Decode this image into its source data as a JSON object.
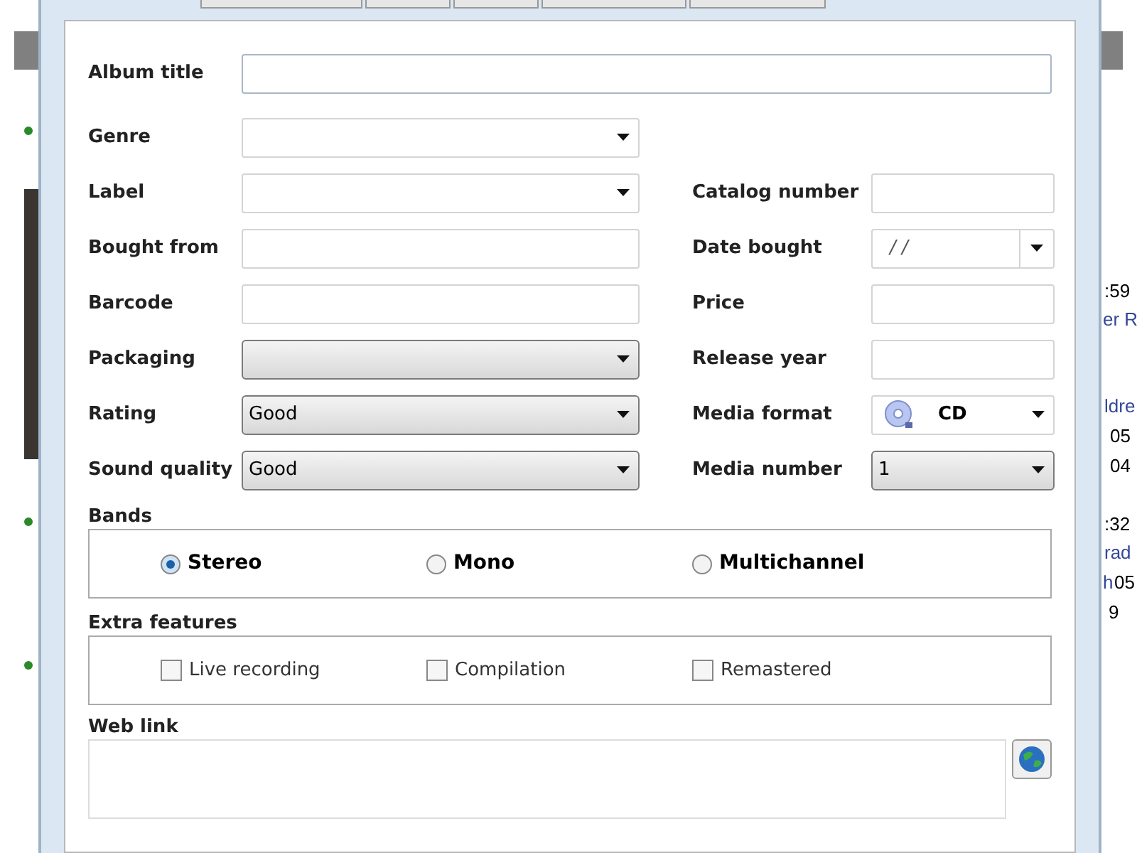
{
  "background_app": {
    "texts": [
      {
        "text": ":59",
        "link": false
      },
      {
        "text": "er R",
        "link": true
      },
      {
        "text": "ldre",
        "link": true
      },
      {
        "text": "05",
        "link": false
      },
      {
        "text": "04",
        "link": false
      },
      {
        "text": ":32",
        "link": false
      },
      {
        "text": "rad",
        "link": true
      },
      {
        "text": "h",
        "link": true
      },
      {
        "text": "05",
        "link": false
      },
      {
        "text": "9",
        "link": false
      }
    ]
  },
  "album_title": {
    "label": "Album title"
  },
  "rows": [
    {
      "left": {
        "label": "Genre",
        "kind": "combo"
      }
    },
    {
      "left": {
        "label": "Label",
        "kind": "combo"
      },
      "right": {
        "label": "Catalog number",
        "kind": "text"
      }
    },
    {
      "left": {
        "label": "Bought from",
        "kind": "text"
      },
      "right": {
        "label": "Date bought",
        "kind": "date",
        "value": "/ /"
      }
    },
    {
      "left": {
        "label": "Barcode",
        "kind": "text"
      },
      "right": {
        "label": "Price",
        "kind": "text"
      }
    },
    {
      "left": {
        "label": "Packaging",
        "kind": "dropdown"
      },
      "right": {
        "label": "Release year",
        "kind": "text"
      }
    },
    {
      "left": {
        "label": "Rating",
        "kind": "dropdown",
        "value": "Good"
      },
      "right": {
        "label": "Media format",
        "kind": "media",
        "value": "CD"
      }
    },
    {
      "left": {
        "label": "Sound quality",
        "kind": "dropdown",
        "value": "Good"
      },
      "right": {
        "label": "Media number",
        "kind": "dropdown",
        "value": "1"
      }
    }
  ],
  "bands": {
    "label": "Bands",
    "options": [
      {
        "label": "Stereo",
        "selected": true
      },
      {
        "label": "Mono",
        "selected": false
      },
      {
        "label": "Multichannel",
        "selected": false
      }
    ]
  },
  "extra_features": {
    "label": "Extra features",
    "options": [
      {
        "label": "Live recording",
        "checked": false
      },
      {
        "label": "Compilation",
        "checked": false
      },
      {
        "label": "Remastered",
        "checked": false
      }
    ]
  },
  "web_link": {
    "label": "Web link"
  }
}
